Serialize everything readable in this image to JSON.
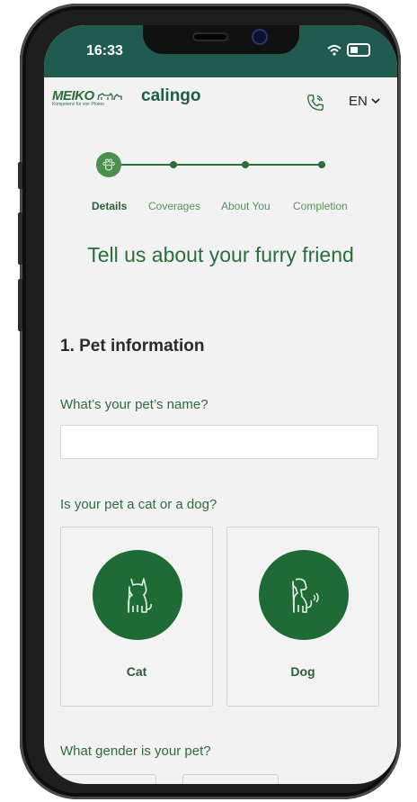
{
  "status": {
    "time": "16:33"
  },
  "header": {
    "brand_meiko": "MEIKO",
    "brand_tagline": "Kompetenz für vier Pfoten",
    "brand_calingo": "calingo",
    "language": "EN"
  },
  "stepper": {
    "steps": [
      "Details",
      "Coverages",
      "About You",
      "Completion"
    ],
    "active_index": 0
  },
  "page": {
    "headline": "Tell us about your furry friend"
  },
  "section": {
    "title": "1. Pet information",
    "name_question": "What’s your pet’s name?",
    "name_value": "",
    "type_question": "Is your pet a cat or a dog?",
    "options": [
      {
        "label": "Cat",
        "icon": "cat-icon"
      },
      {
        "label": "Dog",
        "icon": "dog-icon"
      }
    ],
    "gender_question": "What gender is your pet?"
  },
  "colors": {
    "status_bar": "#1f5b4f",
    "primary_green": "#2b6e3b",
    "button_green": "#1e6b35",
    "screen_bg": "#f2f2f2"
  }
}
